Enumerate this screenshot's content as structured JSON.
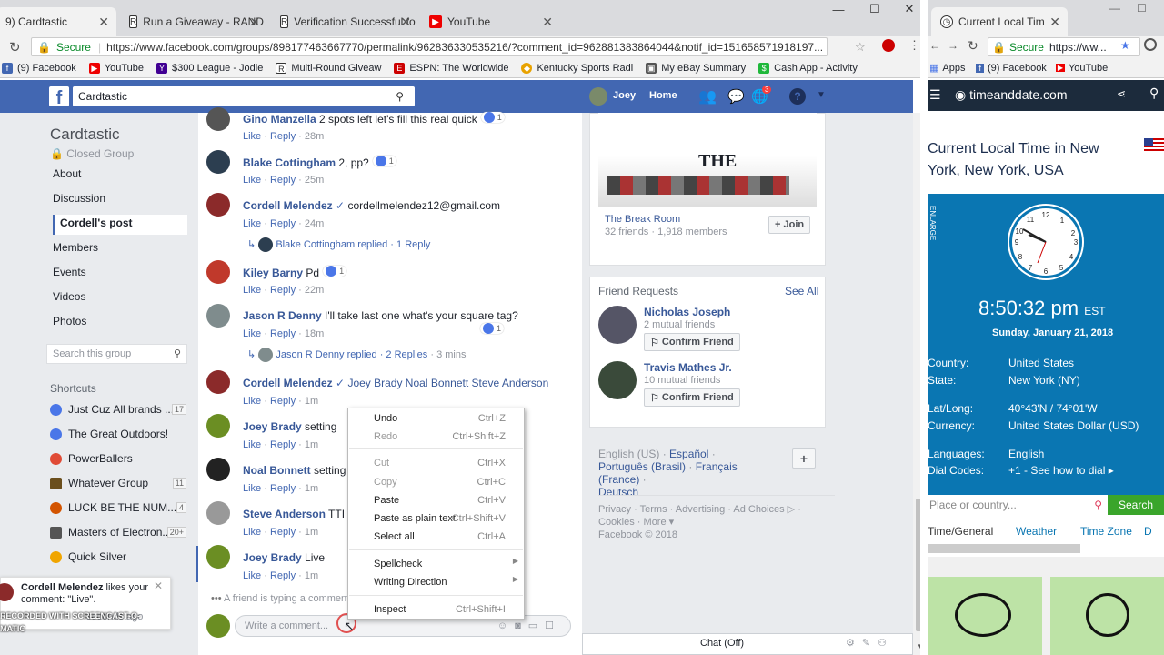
{
  "left_browser": {
    "tabs": [
      {
        "label": "9) Cardtastic",
        "icon": "facebook-icon"
      },
      {
        "label": "Run a Giveaway - RAND",
        "icon": "r-icon"
      },
      {
        "label": "Verification Successful fo",
        "icon": "r-icon"
      },
      {
        "label": "YouTube",
        "icon": "youtube-icon"
      }
    ],
    "secure_label": "Secure",
    "url": "https://www.facebook.com/groups/898177463667770/permalink/962836330535216/?comment_id=962881383864044&notif_id=151658571918197...",
    "bookmarks": [
      "(9) Facebook",
      "YouTube",
      "$300 League - Jodie",
      "Multi-Round Giveaw",
      "ESPN: The Worldwide",
      "Kentucky Sports Radi",
      "My eBay Summary",
      "Cash App - Activity"
    ]
  },
  "facebook": {
    "search_value": "Cardtastic",
    "user_name": "Joey",
    "home_label": "Home",
    "notif_count": "3",
    "group": {
      "title": "Cardtastic",
      "privacy": "Closed Group",
      "nav": [
        "About",
        "Discussion",
        "Cordell's post",
        "Members",
        "Events",
        "Videos",
        "Photos"
      ],
      "search_placeholder": "Search this group",
      "shortcuts_label": "Shortcuts",
      "shortcuts": [
        {
          "name": "Just Cuz All brands ...",
          "count": "17",
          "color": "#4a76e8"
        },
        {
          "name": "The Great Outdoors!",
          "count": "",
          "color": "#4a76e8"
        },
        {
          "name": "PowerBallers",
          "count": "",
          "color": "#e04b36"
        },
        {
          "name": "Whatever Group",
          "count": "11",
          "color": "#6b4f1d"
        },
        {
          "name": "LUCK BE THE NUM...",
          "count": "4",
          "color": "#d35400"
        },
        {
          "name": "Masters of Electron...",
          "count": "20+",
          "color": "#555"
        },
        {
          "name": "Quick Silver",
          "count": "",
          "color": "#f0a500"
        }
      ]
    },
    "comments": [
      {
        "name": "Gino Manzella",
        "text": "2 spots left let's fill this real quick",
        "like": "Like",
        "reply": "Reply",
        "time": "28m",
        "reacts": "1"
      },
      {
        "name": "Blake Cottingham",
        "text": "2, pp?",
        "like": "Like",
        "reply": "Reply",
        "time": "25m",
        "reacts": "1"
      },
      {
        "name": "Cordell Melendez",
        "text": "cordellmelendez12@gmail.com",
        "like": "Like",
        "reply": "Reply",
        "time": "24m",
        "reacts": ""
      },
      {
        "name": "Kiley Barny",
        "text": "Pd",
        "like": "Like",
        "reply": "Reply",
        "time": "22m",
        "reacts": "1"
      },
      {
        "name": "Jason R Denny",
        "text": "I'll take last one what's your square tag?",
        "like": "Like",
        "reply": "Reply",
        "time": "18m",
        "reacts": "1"
      },
      {
        "name": "Cordell Melendez",
        "text": "Joey Brady Noal Bonnett Steve Anderson",
        "like": "Like",
        "reply": "Reply",
        "time": "1m",
        "reacts": ""
      },
      {
        "name": "Joey Brady",
        "text": "setting",
        "like": "Like",
        "reply": "Reply",
        "time": "1m",
        "reacts": ""
      },
      {
        "name": "Noal Bonnett",
        "text": "setting u",
        "like": "Like",
        "reply": "Reply",
        "time": "1m",
        "reacts": ""
      },
      {
        "name": "Steve Anderson",
        "text": "TTINC",
        "like": "Like",
        "reply": "Reply",
        "time": "1m",
        "reacts": ""
      },
      {
        "name": "Joey Brady",
        "text": "Live",
        "like": "Like",
        "reply": "Reply",
        "time": "1m",
        "reacts": ""
      }
    ],
    "replies": [
      {
        "name": "Blake Cottingham",
        "text": "replied · 1 Reply",
        "time": ""
      },
      {
        "name": "Jason R Denny",
        "text": "replied · 2 Replies",
        "time": "3 mins"
      }
    ],
    "typing": "A friend is typing a comment...",
    "comment_placeholder": "Write a comment...",
    "right": {
      "group_card": {
        "title": "The Break Room",
        "meta": "32 friends · 1,918 members",
        "join": "Join",
        "banner": "THE"
      },
      "friend_requests": {
        "title": "Friend Requests",
        "see_all": "See All",
        "people": [
          {
            "name": "Nicholas Joseph",
            "mutual": "2 mutual friends",
            "action": "Confirm Friend"
          },
          {
            "name": "Travis Mathes Jr.",
            "mutual": "10 mutual friends",
            "action": "Confirm Friend"
          }
        ]
      },
      "languages": {
        "current": "English (US)",
        "others": [
          "Español",
          "Português (Brasil)",
          "Français (France)",
          "Deutsch"
        ]
      },
      "footer_links": [
        "Privacy",
        "Terms",
        "Advertising",
        "Ad Choices",
        "Cookies",
        "More"
      ],
      "copyright": "Facebook © 2018"
    },
    "chat_label": "Chat (Off)"
  },
  "context_menu": [
    {
      "label": "Undo",
      "shortcut": "Ctrl+Z",
      "enabled": true
    },
    {
      "label": "Redo",
      "shortcut": "Ctrl+Shift+Z",
      "enabled": false
    },
    {
      "label": "Cut",
      "shortcut": "Ctrl+X",
      "enabled": false
    },
    {
      "label": "Copy",
      "shortcut": "Ctrl+C",
      "enabled": false
    },
    {
      "label": "Paste",
      "shortcut": "Ctrl+V",
      "enabled": true
    },
    {
      "label": "Paste as plain text",
      "shortcut": "Ctrl+Shift+V",
      "enabled": true
    },
    {
      "label": "Select all",
      "shortcut": "Ctrl+A",
      "enabled": true
    },
    {
      "label": "Spellcheck",
      "shortcut": "",
      "enabled": true
    },
    {
      "label": "Writing Direction",
      "shortcut": "",
      "enabled": true
    },
    {
      "label": "Inspect",
      "shortcut": "Ctrl+Shift+I",
      "enabled": true
    }
  ],
  "notification": {
    "name": "Cordell Melendez",
    "text": "likes your comment: \"Live\".",
    "time": "seconds ago"
  },
  "watermark": "RECORDED WITH SCREENCAST-O-MATIC",
  "right_browser": {
    "tab": "Current Local Tim",
    "secure_label": "Secure",
    "url": "https://ww...",
    "bookmarks": [
      "Apps",
      "(9) Facebook",
      "YouTube"
    ],
    "site": "timeanddate.com",
    "heading": "Current Local Time in New York, New York, USA",
    "enlarge": "ENLARGE",
    "time": "8:50:32 pm",
    "tz": "EST",
    "date": "Sunday, January 21, 2018",
    "info": [
      {
        "k": "Country:",
        "v": "United States"
      },
      {
        "k": "State:",
        "v": "New York (NY)"
      },
      {
        "k": "Lat/Long:",
        "v": "40°43'N / 74°01'W"
      },
      {
        "k": "Currency:",
        "v": "United States Dollar (USD)"
      },
      {
        "k": "Languages:",
        "v": "English"
      },
      {
        "k": "Dial Codes:",
        "v": "+1 - See how to dial ▸"
      }
    ],
    "search_placeholder": "Place or country...",
    "search_button": "Search",
    "tabs": [
      "Time/General",
      "Weather",
      "Time Zone",
      "D"
    ]
  }
}
